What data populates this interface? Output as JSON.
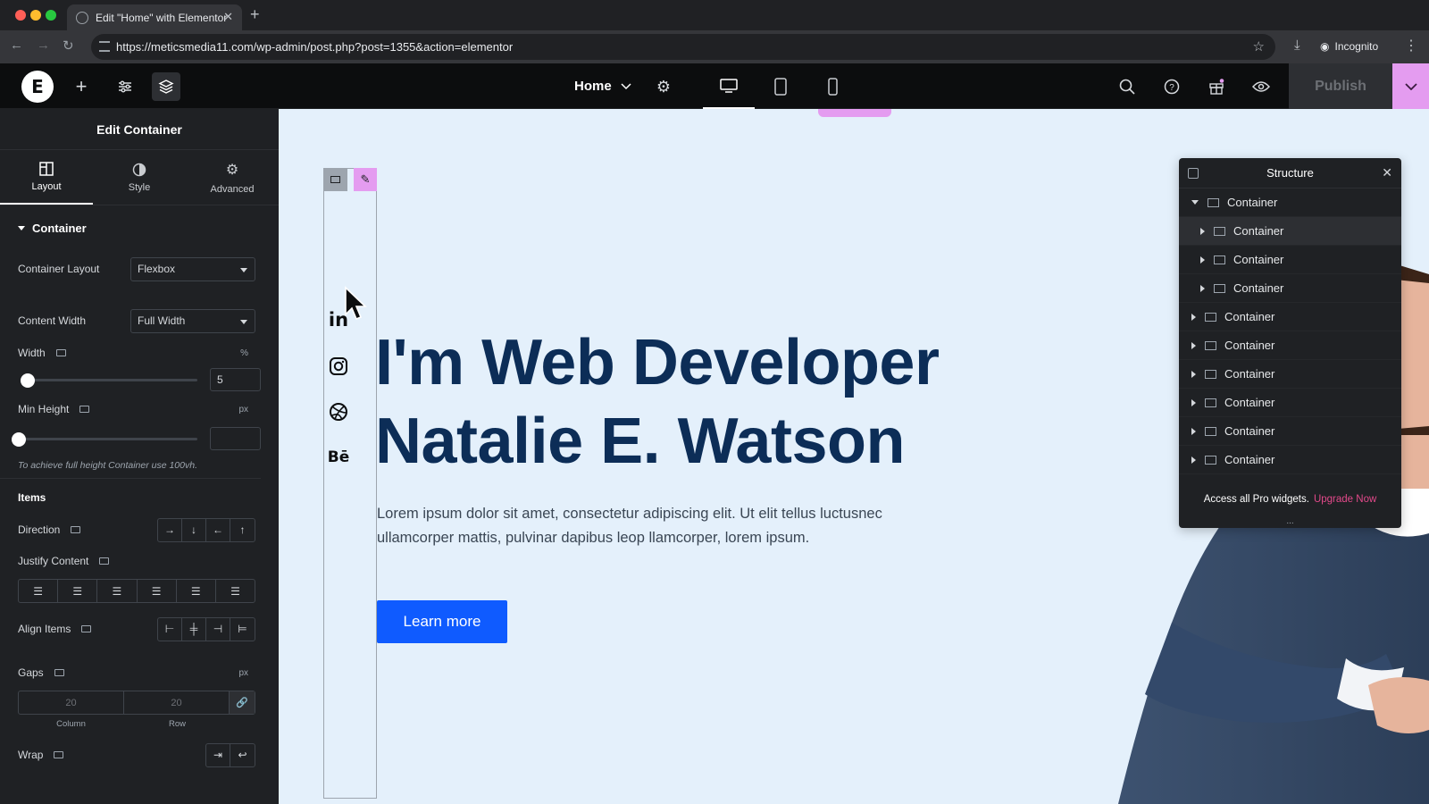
{
  "browser": {
    "tab_title": "Edit \"Home\" with Elementor",
    "url": "https://meticsmedia11.com/wp-admin/post.php?post=1355&action=elementor",
    "incognito_label": "Incognito"
  },
  "topbar": {
    "page_name": "Home",
    "publish_label": "Publish"
  },
  "panel": {
    "title": "Edit Container",
    "tabs": [
      {
        "label": "Layout",
        "icon": "layout-icon"
      },
      {
        "label": "Style",
        "icon": "style-icon"
      },
      {
        "label": "Advanced",
        "icon": "gear-icon"
      }
    ],
    "section": "Container",
    "container_layout_label": "Container Layout",
    "container_layout_value": "Flexbox",
    "content_width_label": "Content Width",
    "content_width_value": "Full Width",
    "width_label": "Width",
    "width_unit": "%",
    "width_value": "5",
    "min_height_label": "Min Height",
    "min_height_unit": "px",
    "min_height_value": "",
    "hint": "To achieve full height Container use 100vh.",
    "items_label": "Items",
    "direction_label": "Direction",
    "justify_label": "Justify Content",
    "align_label": "Align Items",
    "gaps_label": "Gaps",
    "gaps_unit": "px",
    "gap_column_placeholder": "20",
    "gap_row_placeholder": "20",
    "gap_column_label": "Column",
    "gap_row_label": "Row",
    "wrap_label": "Wrap"
  },
  "hero": {
    "title_line1": "I'm Web Developer",
    "title_line2": "Natalie E. Watson",
    "text": "Lorem ipsum dolor sit amet, consectetur adipiscing elit. Ut elit tellus luctusnec ullamcorper mattis, pulvinar dapibus leop llamcorper, lorem ipsum.",
    "cta": "Learn more",
    "socials": [
      "in",
      "instagram-icon",
      "dribbble-icon",
      "Bē"
    ]
  },
  "structure": {
    "title": "Structure",
    "items": [
      {
        "label": "Container",
        "expanded": true
      },
      {
        "label": "Container"
      },
      {
        "label": "Container"
      },
      {
        "label": "Container"
      },
      {
        "label": "Container"
      },
      {
        "label": "Container"
      },
      {
        "label": "Container"
      },
      {
        "label": "Container"
      },
      {
        "label": "Container"
      },
      {
        "label": "Container"
      }
    ],
    "footer_text": "Access all Pro widgets.",
    "footer_link": "Upgrade Now",
    "more": "..."
  },
  "colors": {
    "accent_pink": "#e49cf0",
    "brand_blue": "#0f5bff",
    "hero_title": "#0c2d57",
    "canvas_bg": "#e4f0fb"
  }
}
